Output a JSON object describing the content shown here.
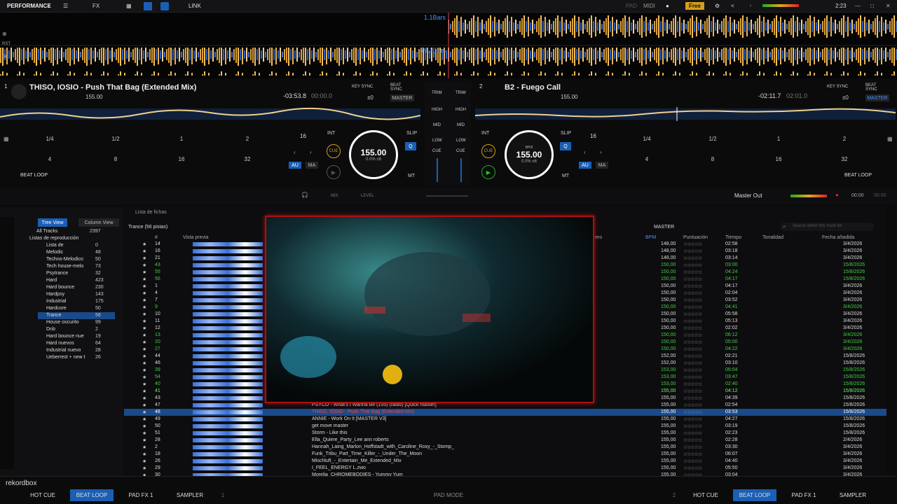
{
  "header": {
    "mode": "PERFORMANCE",
    "link": "LINK",
    "pad": "PAD",
    "midi": "MIDI",
    "plan": "Free",
    "time": "2:23"
  },
  "waveform": {
    "bars1": "1.1Bars",
    "bars2": "79.1Bars"
  },
  "deck1": {
    "num": "1",
    "title": "THISO, IOSIO - Push That Bag (Extended Mix)",
    "bpm": "155.00",
    "remain": "-03:53.8",
    "elapsed": "00:00.0",
    "key_sync": "KEY SYNC",
    "beat_sync": "BEAT SYNC",
    "master": "MASTER",
    "pm": "±0",
    "beat_count": "16",
    "int": "INT",
    "cue": "CUE",
    "jog_bpm": "155.00",
    "jog_sub": "0.0% ±6",
    "slip": "SLIP",
    "q": "Q",
    "au": "AU",
    "ma": "MA",
    "mt": "MT",
    "beat_loop": "BEAT LOOP",
    "pads": [
      "1/4",
      "1/2",
      "1",
      "2",
      "4",
      "8",
      "16",
      "32"
    ]
  },
  "deck2": {
    "num": "2",
    "title": "B2 - Fuego Call",
    "bpm": "155.00",
    "remain": "-02:11.7",
    "elapsed": "02:01.0",
    "key_sync": "KEY SYNC",
    "beat_sync": "BEAT SYNC",
    "master": "MASTER",
    "pm": "±0",
    "beat_count": "16",
    "int": "INT",
    "cue": "CUE",
    "jog_label": "BPM",
    "jog_bpm": "155.00",
    "jog_sub": "0.0% ±6",
    "slip": "SLIP",
    "q": "Q",
    "au": "AU",
    "ma": "MA",
    "mt": "MT",
    "beat_loop": "BEAT LOOP",
    "pads": [
      "1/4",
      "1/2",
      "1",
      "2",
      "4",
      "8",
      "16",
      "32"
    ]
  },
  "mixer": {
    "trim": "TRIM",
    "high": "HIGH",
    "mid": "MID",
    "low": "LOW",
    "cue": "CUE",
    "mix": "MIX",
    "level": "LEVEL",
    "master_out": "Master Out",
    "time": "00:00",
    "time2": "00:00"
  },
  "browser": {
    "tree_view": "Tree View",
    "column_view": "Column View",
    "list_de_fichas": "Lista de fichas",
    "playlist_header": "Trance (56 pistas)",
    "master": "MASTER",
    "search_placeholder": "Search within this track list",
    "tree": [
      {
        "label": "All Tracks",
        "count": "2397"
      },
      {
        "label": "Listas de reproducción",
        "count": ""
      },
      {
        "label": "Lista de",
        "count": "0"
      },
      {
        "label": "Melodic",
        "count": "48"
      },
      {
        "label": "Techno-Melodico",
        "count": "50"
      },
      {
        "label": "Tech house-melo",
        "count": "73"
      },
      {
        "label": "Psytrance",
        "count": "32"
      },
      {
        "label": "Hard",
        "count": "423"
      },
      {
        "label": "Hard bounce",
        "count": "230"
      },
      {
        "label": "Hardpsy",
        "count": "143"
      },
      {
        "label": "Industrial",
        "count": "175"
      },
      {
        "label": "Hardcore",
        "count": "50"
      },
      {
        "label": "Trance",
        "count": "56"
      },
      {
        "label": "House oscurito",
        "count": "99"
      },
      {
        "label": "Dnb",
        "count": "2"
      },
      {
        "label": "Hard bounce nue",
        "count": "19"
      },
      {
        "label": "Hard nuevos",
        "count": "64"
      },
      {
        "label": "Industrial nuevo",
        "count": "28"
      },
      {
        "label": "Ueberrest + new t",
        "count": "26"
      }
    ],
    "columns": [
      "#",
      "Vista previa",
      "BPM",
      "Puntuación",
      "Tiempo",
      "Tonalidad",
      "Fecha añadida"
    ],
    "col_ero": "ero",
    "rows": [
      {
        "n": "14",
        "bpm": "148,00",
        "t": "02:58",
        "d": "3/4/2026",
        "c": "w"
      },
      {
        "n": "16",
        "bpm": "148,00",
        "t": "03:18",
        "d": "3/4/2026",
        "c": "w"
      },
      {
        "n": "21",
        "bpm": "148,00",
        "t": "03:14",
        "d": "3/4/2026",
        "c": "w"
      },
      {
        "n": "43",
        "bpm": "150,00",
        "t": "03:00",
        "d": "15/8/2026",
        "c": "g"
      },
      {
        "n": "55",
        "bpm": "150,00",
        "t": "04:24",
        "d": "15/8/2026",
        "c": "g"
      },
      {
        "n": "56",
        "bpm": "150,00",
        "t": "04:17",
        "d": "15/8/2026",
        "c": "g"
      },
      {
        "n": "1",
        "bpm": "150,00",
        "t": "04:17",
        "d": "3/4/2026",
        "c": "w"
      },
      {
        "n": "4",
        "bpm": "150,00",
        "t": "02:04",
        "d": "3/4/2026",
        "c": "w"
      },
      {
        "n": "7",
        "bpm": "150,00",
        "t": "03:52",
        "d": "3/4/2026",
        "c": "w"
      },
      {
        "n": "9",
        "bpm": "150,00",
        "t": "04:41",
        "d": "3/4/2026",
        "c": "g"
      },
      {
        "n": "10",
        "bpm": "150,00",
        "t": "05:58",
        "d": "3/4/2026",
        "c": "w"
      },
      {
        "n": "11",
        "bpm": "150,00",
        "t": "05:13",
        "d": "3/4/2026",
        "c": "w"
      },
      {
        "n": "12",
        "bpm": "150,00",
        "t": "02:02",
        "d": "3/4/2026",
        "c": "w"
      },
      {
        "n": "13",
        "bpm": "150,00",
        "t": "06:12",
        "d": "3/4/2026",
        "c": "g"
      },
      {
        "n": "20",
        "bpm": "150,00",
        "t": "05:00",
        "d": "3/4/2026",
        "c": "g"
      },
      {
        "n": "27",
        "bpm": "150,00",
        "t": "04:22",
        "d": "3/4/2026",
        "c": "g"
      },
      {
        "n": "44",
        "bpm": "152,00",
        "t": "02:21",
        "d": "15/8/2026",
        "c": "w"
      },
      {
        "n": "46",
        "bpm": "152,00",
        "t": "03:10",
        "d": "15/8/2026",
        "c": "w"
      },
      {
        "n": "39",
        "bpm": "153,00",
        "t": "05:04",
        "d": "15/8/2026",
        "c": "g"
      },
      {
        "n": "54",
        "bpm": "153,00",
        "t": "03:47",
        "d": "15/8/2026",
        "c": "g"
      },
      {
        "n": "40",
        "bpm": "153,00",
        "t": "02:40",
        "d": "15/8/2026",
        "c": "g"
      },
      {
        "n": "41",
        "bpm": "155,00",
        "t": "04:12",
        "d": "15/8/2026",
        "c": "gb"
      },
      {
        "n": "43",
        "bpm": "155,00",
        "t": "04:39",
        "d": "15/8/2026",
        "c": "w"
      },
      {
        "n": "47",
        "bpm": "155,00",
        "t": "02:54",
        "d": "15/8/2026",
        "c": "w",
        "title": "PSYCO - What's I Wanna Be (155) (radio) [Quick master]"
      },
      {
        "n": "48",
        "bpm": "155,00",
        "t": "03:53",
        "d": "15/8/2026",
        "c": "sel",
        "title": "THISO, IOSIO - Push That Bag (Extended Mix)"
      },
      {
        "n": "49",
        "bpm": "155,00",
        "t": "04:27",
        "d": "15/8/2026",
        "c": "w",
        "title": "ANNIE - Work On It [MASTER V3]"
      },
      {
        "n": "50",
        "bpm": "155,00",
        "t": "03:19",
        "d": "15/8/2026",
        "c": "w",
        "title": "get move master"
      },
      {
        "n": "51",
        "bpm": "155,00",
        "t": "02:23",
        "d": "15/8/2026",
        "c": "w",
        "title": "Storm - Like this"
      },
      {
        "n": "28",
        "bpm": "155,00",
        "t": "02:28",
        "d": "2/4/2026",
        "c": "w",
        "title": "Ella_Quiere_Party_Lee ann roberts"
      },
      {
        "n": "2",
        "bpm": "155,00",
        "t": "03:30",
        "d": "3/4/2026",
        "c": "w",
        "title": "Hannah_Laing_Marlon_Hoffstadt_with_Caroline_Roxy_-_Stomp_"
      },
      {
        "n": "18",
        "bpm": "155,00",
        "t": "06:07",
        "d": "3/4/2026",
        "c": "w",
        "title": "Funk_Tribu_Part_Time_Killer_-_Under_The_Moon"
      },
      {
        "n": "26",
        "bpm": "155,00",
        "t": "04:40",
        "d": "3/4/2026",
        "c": "w",
        "title": "Mischluft_-_Entertain_Me_Extended_Mix"
      },
      {
        "n": "29",
        "bpm": "155,00",
        "t": "05:50",
        "d": "3/4/2026",
        "c": "w",
        "title": "I_FEEL_ENERGY L.zwo"
      },
      {
        "n": "30",
        "bpm": "155,00",
        "t": "03:04",
        "d": "3/4/2026",
        "c": "w",
        "title": "Morelia_CHROMEBODIES - Yummy Yum"
      }
    ]
  },
  "bottom": {
    "logo": "rekordbox",
    "hot_cue": "HOT CUE",
    "beat_loop": "BEAT LOOP",
    "pad_fx": "PAD FX 1",
    "sampler": "SAMPLER",
    "pad_mode": "PAD MODE",
    "one": "1",
    "two": "2"
  }
}
